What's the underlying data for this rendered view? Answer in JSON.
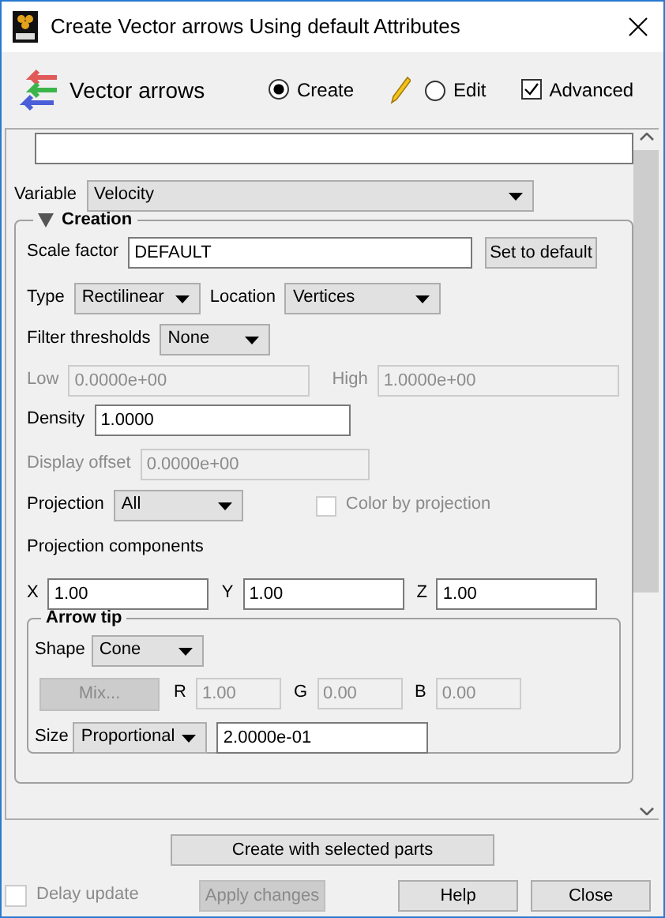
{
  "window": {
    "title": "Create Vector arrows Using default Attributes"
  },
  "header": {
    "title": "Vector arrows",
    "modes": [
      {
        "label": "Create",
        "selected": true
      },
      {
        "label": "Edit",
        "selected": false
      }
    ],
    "advanced": {
      "label": "Advanced",
      "checked": true
    }
  },
  "variable": {
    "label": "Variable",
    "value": "Velocity"
  },
  "creation": {
    "title": "Creation",
    "expanded": true,
    "scale_factor": {
      "label": "Scale factor",
      "value": "DEFAULT",
      "button": "Set to default"
    },
    "type": {
      "label": "Type",
      "value": "Rectilinear"
    },
    "location": {
      "label": "Location",
      "value": "Vertices"
    },
    "filter_thresholds": {
      "label": "Filter thresholds",
      "value": "None"
    },
    "low": {
      "label": "Low",
      "value": "0.0000e+00",
      "disabled": true
    },
    "high": {
      "label": "High",
      "value": "1.0000e+00",
      "disabled": true
    },
    "density": {
      "label": "Density",
      "value": "1.0000",
      "disabled": false
    },
    "display_offset": {
      "label": "Display offset",
      "value": "0.0000e+00",
      "disabled": true
    },
    "projection": {
      "label": "Projection",
      "value": "All"
    },
    "color_by_projection": {
      "label": "Color by projection",
      "checked": false,
      "disabled": true
    },
    "projection_components": {
      "label": "Projection components",
      "fields": [
        {
          "label": "X",
          "value": "1.00"
        },
        {
          "label": "Y",
          "value": "1.00"
        },
        {
          "label": "Z",
          "value": "1.00"
        }
      ]
    },
    "arrow_tip": {
      "title": "Arrow tip",
      "shape": {
        "label": "Shape",
        "value": "Cone"
      },
      "mix": {
        "label": "Mix...",
        "disabled": true
      },
      "rgb": [
        {
          "label": "R",
          "value": "1.00",
          "disabled": true
        },
        {
          "label": "G",
          "value": "0.00",
          "disabled": true
        },
        {
          "label": "B",
          "value": "0.00",
          "disabled": true
        }
      ],
      "size": {
        "label": "Size",
        "value": "Proportional",
        "amount": "2.0000e-01"
      }
    }
  },
  "create_button": "Create with selected parts",
  "footer": {
    "delay_update": {
      "label": "Delay update",
      "checked": false,
      "disabled": true
    },
    "apply": {
      "label": "Apply changes",
      "disabled": true
    },
    "buttons": [
      "Help",
      "Close"
    ]
  }
}
